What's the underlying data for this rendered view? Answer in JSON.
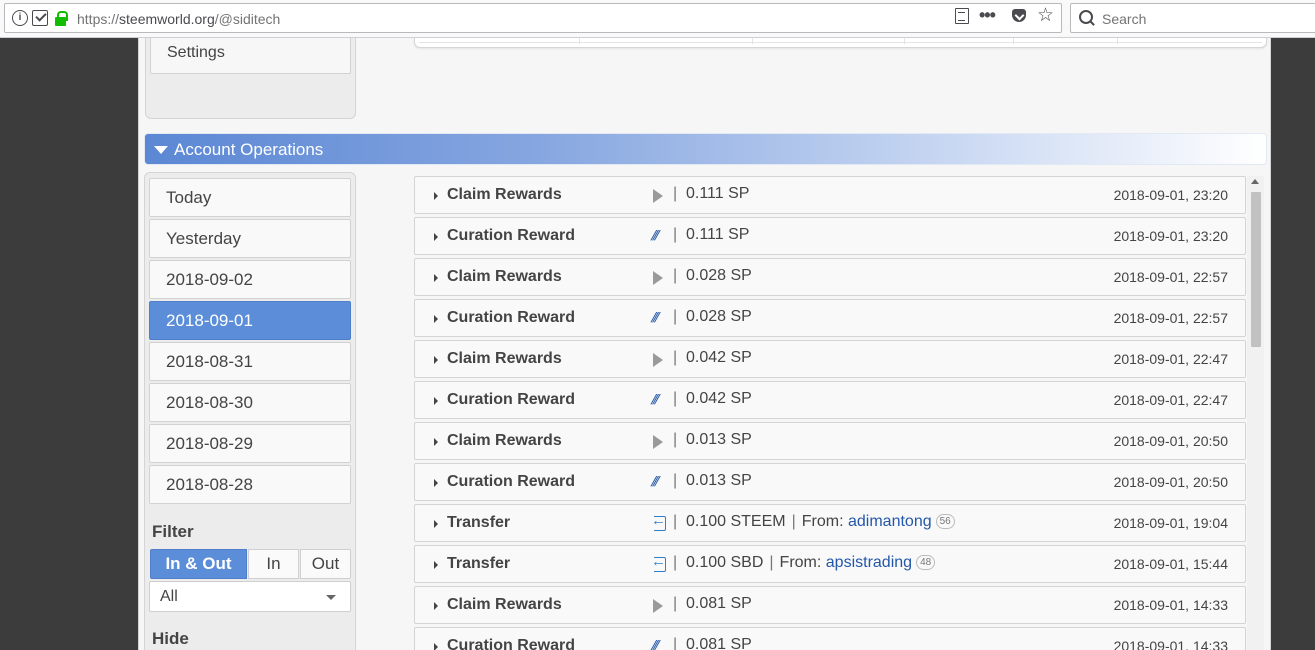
{
  "browser": {
    "url_proto": "https://",
    "url_host": "steemworld.org",
    "url_path": "/@siditech",
    "search_placeholder": "Search",
    "dots": "•••",
    "star": "☆",
    "info": "i"
  },
  "sidebar_top": {
    "settings_label": "Settings"
  },
  "section": {
    "title": "Account Operations"
  },
  "dates": [
    "Today",
    "Yesterday",
    "2018-09-02",
    "2018-09-01",
    "2018-08-31",
    "2018-08-30",
    "2018-08-29",
    "2018-08-28"
  ],
  "active_date": "2018-09-01",
  "filter": {
    "label": "Filter",
    "segments": [
      "In & Out",
      "In",
      "Out"
    ],
    "active_segment": "In & Out",
    "select_value": "All"
  },
  "hide_label": "Hide",
  "icons": {
    "claim": "play-icon",
    "curation": "steem-icon",
    "transfer": "transfer-icon"
  },
  "operations": [
    {
      "name": "Claim Rewards",
      "icon": "claim",
      "amount": "0.111 SP",
      "date": "2018-09-01, 23:20"
    },
    {
      "name": "Curation Reward",
      "icon": "curation",
      "amount": "0.111 SP",
      "date": "2018-09-01, 23:20"
    },
    {
      "name": "Claim Rewards",
      "icon": "claim",
      "amount": "0.028 SP",
      "date": "2018-09-01, 22:57"
    },
    {
      "name": "Curation Reward",
      "icon": "curation",
      "amount": "0.028 SP",
      "date": "2018-09-01, 22:57"
    },
    {
      "name": "Claim Rewards",
      "icon": "claim",
      "amount": "0.042 SP",
      "date": "2018-09-01, 22:47"
    },
    {
      "name": "Curation Reward",
      "icon": "curation",
      "amount": "0.042 SP",
      "date": "2018-09-01, 22:47"
    },
    {
      "name": "Claim Rewards",
      "icon": "claim",
      "amount": "0.013 SP",
      "date": "2018-09-01, 20:50"
    },
    {
      "name": "Curation Reward",
      "icon": "curation",
      "amount": "0.013 SP",
      "date": "2018-09-01, 20:50"
    },
    {
      "name": "Transfer",
      "icon": "transfer",
      "amount": "0.100 STEEM",
      "from_label": "From:",
      "from_user": "adimantong",
      "rep": "56",
      "date": "2018-09-01, 19:04"
    },
    {
      "name": "Transfer",
      "icon": "transfer",
      "amount": "0.100 SBD",
      "from_label": "From:",
      "from_user": "apsistrading",
      "rep": "48",
      "date": "2018-09-01, 15:44"
    },
    {
      "name": "Claim Rewards",
      "icon": "claim",
      "amount": "0.081 SP",
      "date": "2018-09-01, 14:33"
    },
    {
      "name": "Curation Reward",
      "icon": "curation",
      "amount": "0.081 SP",
      "date": "2018-09-01, 14:33"
    }
  ],
  "colors": {
    "accent": "#5b8dd9",
    "link": "#2457a8",
    "lock": "#12bc00"
  }
}
